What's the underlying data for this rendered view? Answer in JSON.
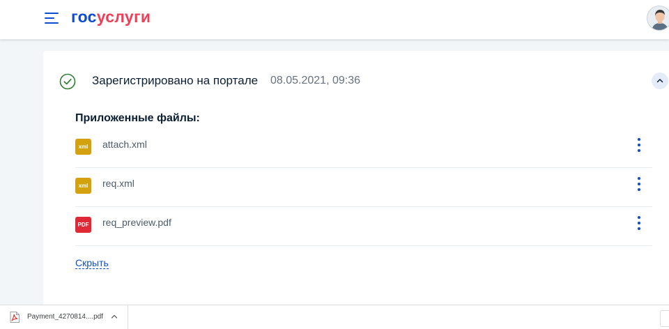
{
  "header": {
    "logo_part1": "гос",
    "logo_part2": "услуги",
    "brand_color": "#0d4cd3",
    "accent_color": "#ee3f58"
  },
  "status": {
    "title": "Зарегистрировано на портале",
    "date": "08.05.2021, 09:36",
    "icon": "check-circle-icon",
    "icon_color": "#2e7d32"
  },
  "attachments": {
    "heading": "Приложенные файлы:",
    "files": [
      {
        "name": "attach.xml",
        "type": "xml",
        "badge_color": "#d4a10f"
      },
      {
        "name": "req.xml",
        "type": "xml",
        "badge_color": "#d4a10f"
      },
      {
        "name": "req_preview.pdf",
        "type": "PDF",
        "badge_color": "#e02936"
      }
    ]
  },
  "hide_link": "Скрыть",
  "downloads": {
    "file_name": "Payment_4270814....pdf"
  }
}
